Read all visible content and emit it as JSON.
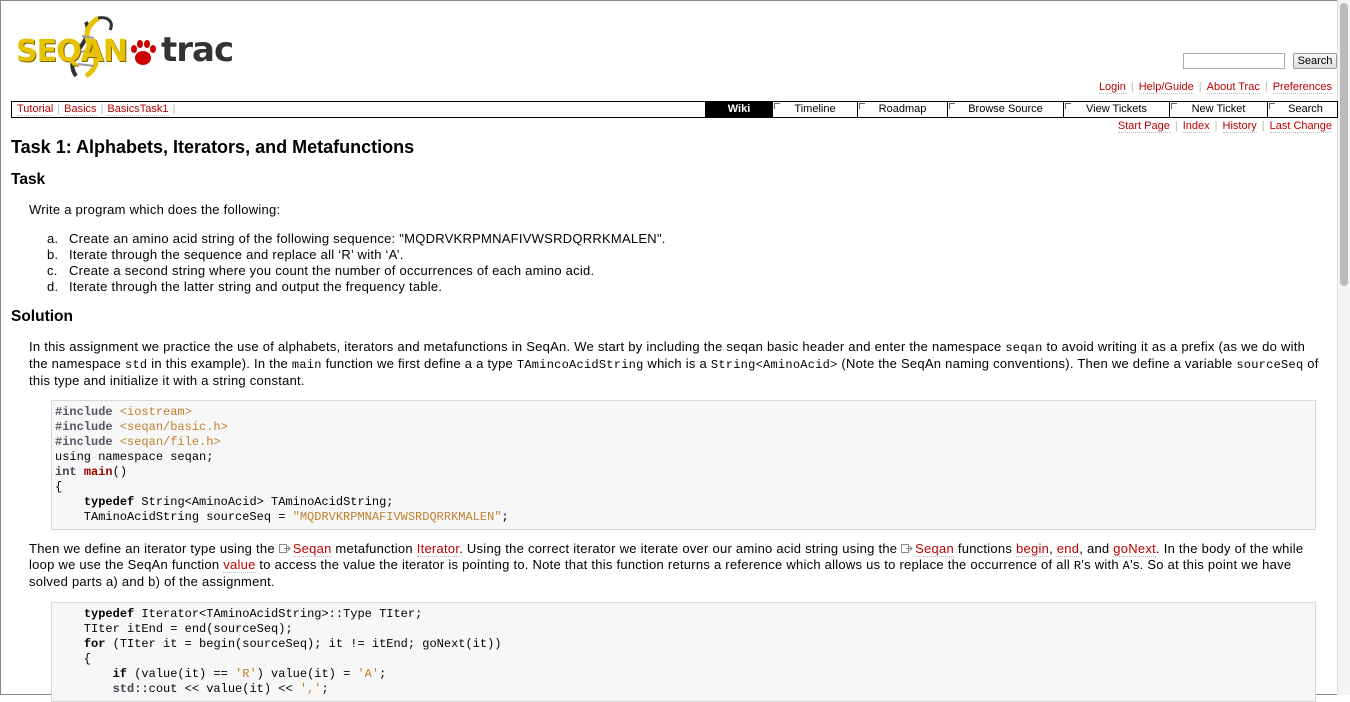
{
  "header": {
    "logo_text_left": "SEQAN",
    "logo_text_right": "trac",
    "search_button": "Search",
    "search_value": ""
  },
  "metanav": [
    "Login",
    "Help/Guide",
    "About Trac",
    "Preferences"
  ],
  "ctxnav": [
    "Tutorial",
    "Basics",
    "BasicsTask1"
  ],
  "mainnav": [
    {
      "label": "Wiki",
      "active": true
    },
    {
      "label": "Timeline"
    },
    {
      "label": "Roadmap"
    },
    {
      "label": "Browse Source"
    },
    {
      "label": "View Tickets"
    },
    {
      "label": "New Ticket"
    },
    {
      "label": "Search"
    }
  ],
  "ctxlinks": [
    "Start Page",
    "Index",
    "History",
    "Last Change"
  ],
  "page": {
    "title": "Task 1: Alphabets, Iterators, and Metafunctions",
    "task_heading": "Task",
    "task_intro": "Write a program which does the following:",
    "task_items": [
      {
        "marker": "a.",
        "text": "Create an amino acid string of the following sequence: \"MQDRVKRPMNAFIVWSRDQRRKMALEN\"."
      },
      {
        "marker": "b.",
        "text": "Iterate through the sequence and replace all ‘R’ with ‘A’."
      },
      {
        "marker": "c.",
        "text": "Create a second string where you count the number of occurrences of each amino acid."
      },
      {
        "marker": "d.",
        "text": "Iterate through the latter string and output the frequency table."
      }
    ],
    "solution_heading": "Solution",
    "sol_p1": {
      "t1": "In this assignment we practice the use of alphabets, iterators and metafunctions in SeqAn. We start by including the seqan basic header and enter the namespace ",
      "c1": "seqan",
      "t2": " to avoid writing it as a prefix (as we do with the namespace ",
      "c2": "std",
      "t3": " in this example). In the ",
      "c3": "main",
      "t4": " function we first define a a type ",
      "c4": "TAmincoAcidString",
      "t5": " which is a ",
      "c5": "String<AminoAcid>",
      "t6": " (Note the SeqAn naming conventions). Then we define a variable ",
      "c6": "sourceSeq",
      "t7": " of this type and initialize it with a string constant."
    },
    "sol_p2": {
      "t1": "Then we define an iterator type using the ",
      "l1": "Seqan",
      "t2": " metafunction ",
      "l2": "Iterator",
      "t3": ". Using the correct iterator we iterate over our amino acid string using the ",
      "l3": "Seqan",
      "t4": " functions ",
      "l4": "begin",
      "t5": ", ",
      "l5": "end",
      "t6": ", and ",
      "l6": "goNext",
      "t7": ". In the body of the while loop we use the SeqAn function ",
      "l7": "value",
      "t8": " to access the value the iterator is pointing to. Note that this function returns a reference which allows us to replace the occurrence of all ",
      "c1": "R",
      "t9": "'s with ",
      "c2": "A",
      "t10": "'s. So at this point we have solved parts a) and b) of the assignment."
    },
    "code1": {
      "inc1": "<iostream>",
      "inc2": "<seqan/basic.h>",
      "inc3": "<seqan/file.h>",
      "using_line": "using namespace seqan;",
      "string_literal": "\"MQDRVKRPMNAFIVWSRDQRRKMALEN\""
    },
    "code2": {
      "char_r": "'R'",
      "char_a": "'A'",
      "char_comma": "','"
    }
  }
}
